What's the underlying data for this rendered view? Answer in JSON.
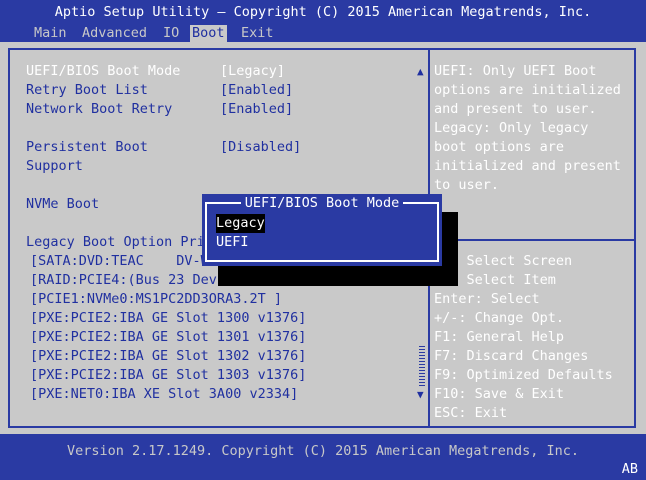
{
  "title": "Aptio Setup Utility – Copyright (C) 2015 American Megatrends, Inc.",
  "menu": [
    "Main",
    "Advanced",
    "IO",
    "Boot",
    "Exit"
  ],
  "active_menu": "Boot",
  "settings": [
    {
      "label": "UEFI/BIOS Boot Mode",
      "value": "[Legacy]",
      "selected": true
    },
    {
      "label": "Retry Boot List",
      "value": "[Enabled]"
    },
    {
      "label": "Network Boot Retry",
      "value": "[Enabled]"
    },
    {
      "label": "Persistent Boot",
      "value": "[Disabled]"
    },
    {
      "label": "Support",
      "value": ""
    },
    {
      "label": "NVMe Boot",
      "value": ""
    }
  ],
  "legacy_header": "Legacy Boot Option Pri",
  "legacy_items": [
    "[SATA:DVD:TEAC    DV-W",
    "[RAID:PCIE4:(Bus 23 Dev",
    "[PCIE1:NVMe0:MS1PC2DD3ORA3.2T ]",
    "[PXE:PCIE2:IBA GE Slot 1300 v1376]",
    "[PXE:PCIE2:IBA GE Slot 1301 v1376]",
    "[PXE:PCIE2:IBA GE Slot 1302 v1376]",
    "[PXE:PCIE2:IBA GE Slot 1303 v1376]",
    "[PXE:NET0:IBA XE Slot 3A00 v2334]"
  ],
  "help_text": [
    "UEFI: Only UEFI Boot",
    "options are initialized",
    "and present to user.",
    "Legacy: Only legacy",
    "boot options are",
    "initialized and present",
    "to user."
  ],
  "keys": [
    "→←: Select Screen",
    "↑↓: Select Item",
    "Enter: Select",
    "+/-: Change Opt.",
    "F1: General Help",
    "F7: Discard Changes",
    "F9: Optimized Defaults",
    "F10: Save & Exit",
    "ESC: Exit"
  ],
  "dialog": {
    "title": "UEFI/BIOS Boot Mode",
    "options": [
      "Legacy",
      "UEFI"
    ],
    "selected": "Legacy"
  },
  "footer": "Version 2.17.1249. Copyright (C) 2015 American Megatrends, Inc.",
  "corner_badge": "AB",
  "icons": {
    "scroll_up": "▲",
    "scroll_down": "▼"
  },
  "colors": {
    "bg": "#c9c9c9",
    "bar": "#2a3aa3",
    "text": "#2030a0",
    "highlight": "#ffffff"
  }
}
